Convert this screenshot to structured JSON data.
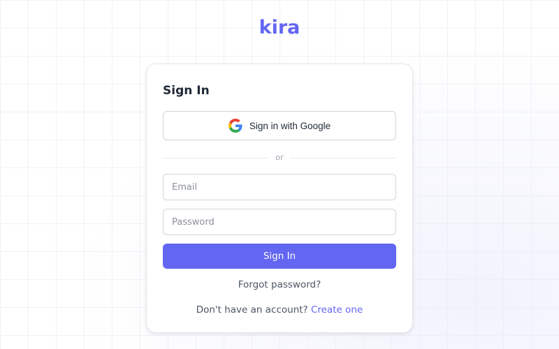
{
  "brand": {
    "logo_text": "kira",
    "accent_color": "#6366f1"
  },
  "login_card": {
    "title": "Sign In",
    "google_button": {
      "label": "Sign in with Google",
      "icon": "google-icon"
    },
    "divider_text": "or",
    "email_field": {
      "placeholder": "Email",
      "value": ""
    },
    "password_field": {
      "placeholder": "Password",
      "value": ""
    },
    "submit_label": "Sign In",
    "forgot_password_link": "Forgot password?",
    "signup_prompt": "Don't have an account?",
    "signup_link": "Create one"
  }
}
